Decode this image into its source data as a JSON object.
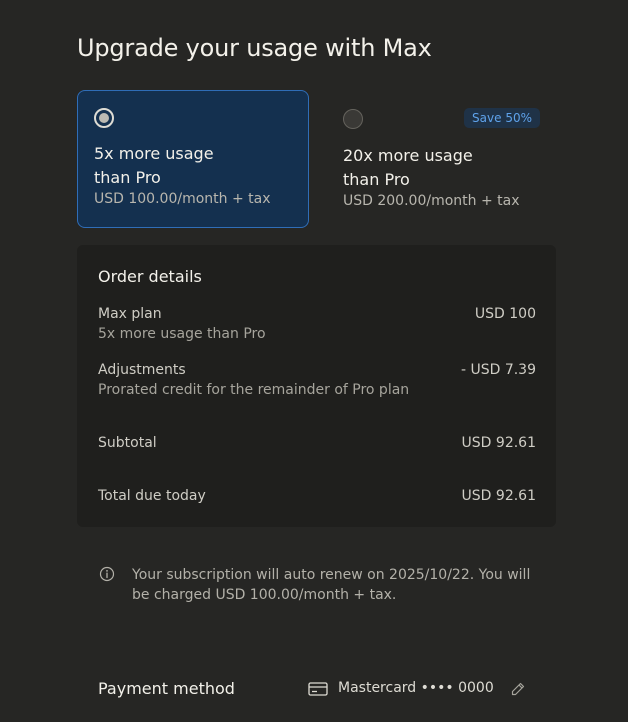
{
  "title": "Upgrade your usage with Max",
  "plans": [
    {
      "name": "5x more usage than Pro",
      "name_line1": "5x more usage",
      "name_line2": "than Pro",
      "price": "USD 100.00/month + tax",
      "selected": true
    },
    {
      "name": "20x more usage than Pro",
      "name_line1": "20x more usage",
      "name_line2": "than Pro",
      "price": "USD 200.00/month + tax",
      "selected": false,
      "badge": "Save 50%"
    }
  ],
  "order": {
    "heading": "Order details",
    "plan_label": "Max plan",
    "plan_sub": "5x more usage than Pro",
    "plan_value": "USD 100",
    "adjust_label": "Adjustments",
    "adjust_sub": "Prorated credit for the remainder of Pro plan",
    "adjust_value": "- USD 7.39",
    "subtotal_label": "Subtotal",
    "subtotal_value": "USD 92.61",
    "total_label": "Total due today",
    "total_value": "USD 92.61"
  },
  "notice": "Your subscription will auto renew on 2025/10/22. You will be charged USD 100.00/month + tax.",
  "payment": {
    "label": "Payment method",
    "card": "Mastercard •••• 0000"
  },
  "colors": {
    "background": "#262624",
    "selected_card": "#14304f",
    "selected_border": "#2f6db7",
    "badge_text": "#5fa2ea"
  },
  "icons": [
    "info-icon",
    "credit-card-icon",
    "pencil-icon"
  ]
}
